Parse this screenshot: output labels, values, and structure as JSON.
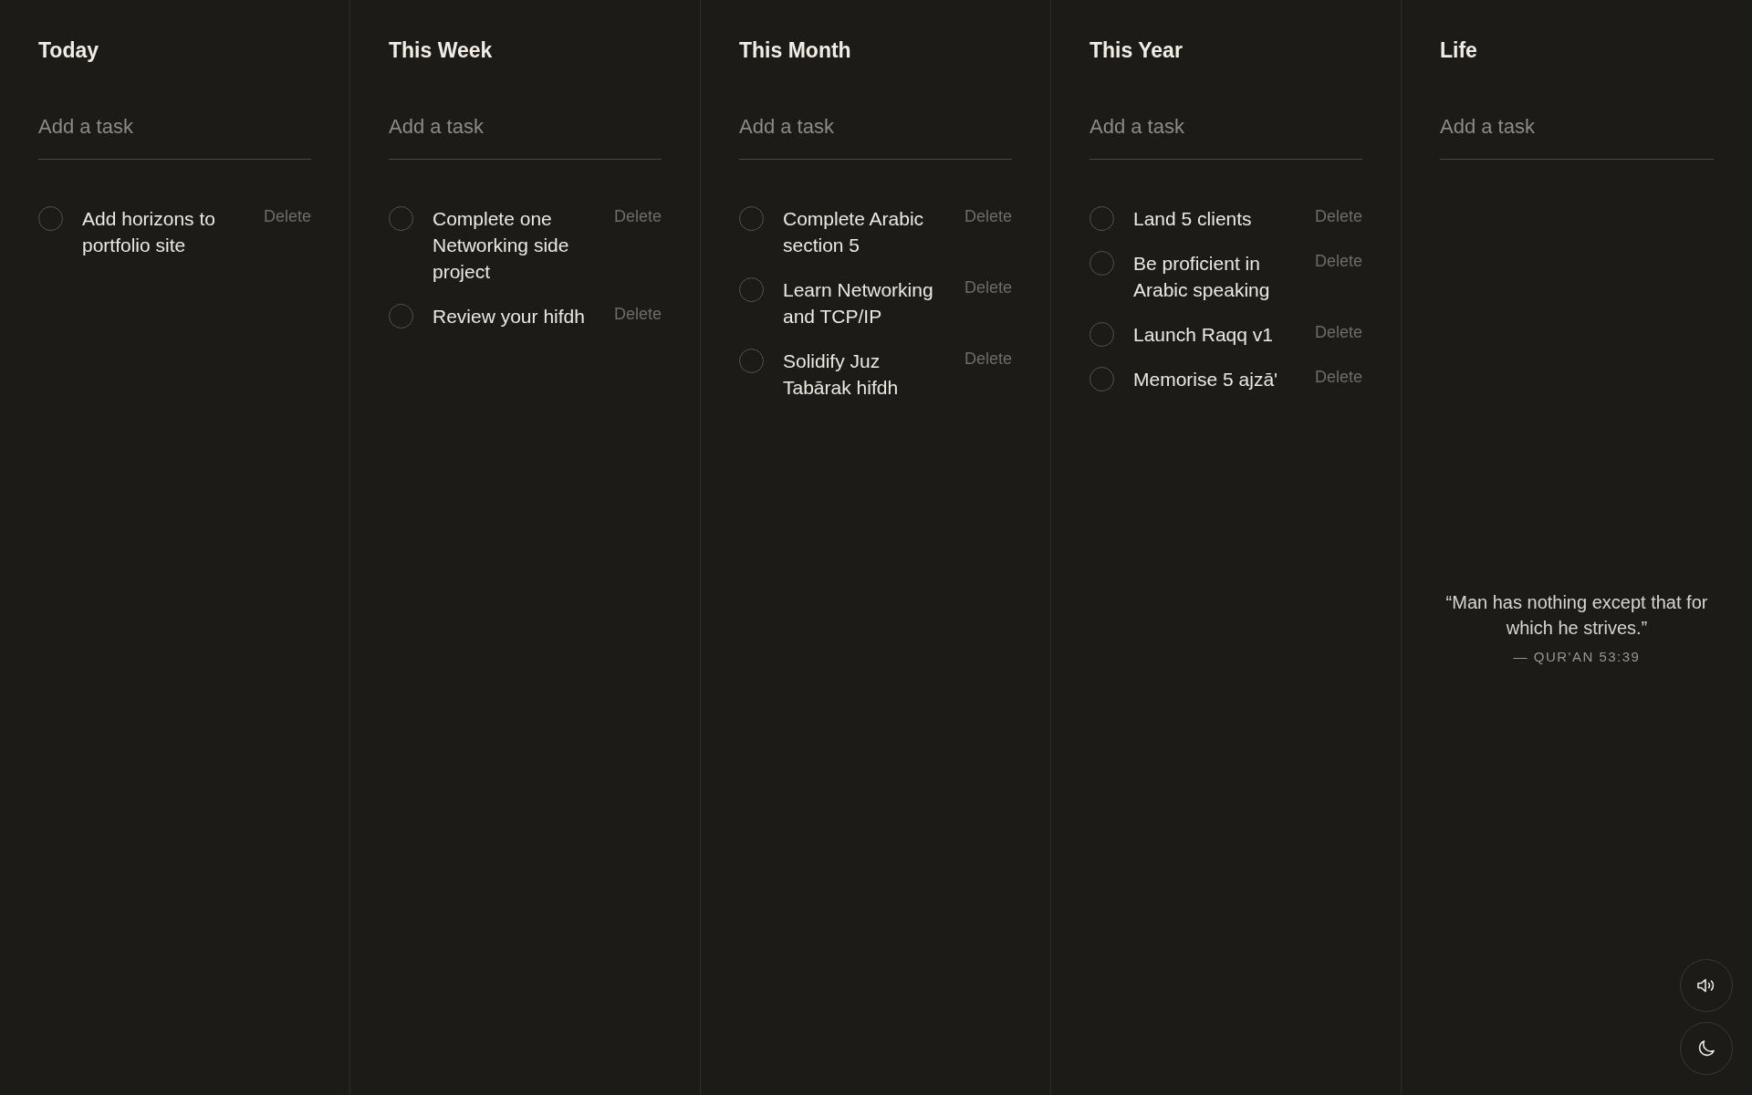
{
  "columns": [
    {
      "title": "Today",
      "input": {
        "placeholder": "Add a task"
      },
      "tasks": [
        {
          "text": "Add horizons to portfolio site",
          "checked": false,
          "action": "Delete"
        }
      ]
    },
    {
      "title": "This Week",
      "input": {
        "placeholder": "Add a task"
      },
      "tasks": [
        {
          "text": "Complete one Networking side project",
          "checked": false,
          "action": "Delete"
        },
        {
          "text": "Review your hifdh",
          "checked": false,
          "action": "Delete"
        }
      ]
    },
    {
      "title": "This Month",
      "input": {
        "placeholder": "Add a task"
      },
      "tasks": [
        {
          "text": "Complete Arabic section 5",
          "checked": false,
          "action": "Delete"
        },
        {
          "text": "Learn Networking and TCP/IP",
          "checked": false,
          "action": "Delete"
        },
        {
          "text": "Solidify Juz Tabārak hifdh",
          "checked": false,
          "action": "Delete"
        }
      ]
    },
    {
      "title": "This Year",
      "input": {
        "placeholder": "Add a task"
      },
      "tasks": [
        {
          "text": "Land 5 clients",
          "checked": false,
          "action": "Delete"
        },
        {
          "text": "Be proficient in Arabic speaking",
          "checked": false,
          "action": "Delete"
        },
        {
          "text": "Launch Raqq v1",
          "checked": false,
          "action": "Delete"
        },
        {
          "text": "Memorise 5 ajzā'",
          "checked": false,
          "action": "Delete"
        }
      ]
    },
    {
      "title": "Life",
      "input": {
        "placeholder": "Add a task"
      },
      "quote": {
        "text": "“Man has nothing except that for which he strives.”",
        "source": "— QUR'AN 53:39"
      }
    }
  ]
}
